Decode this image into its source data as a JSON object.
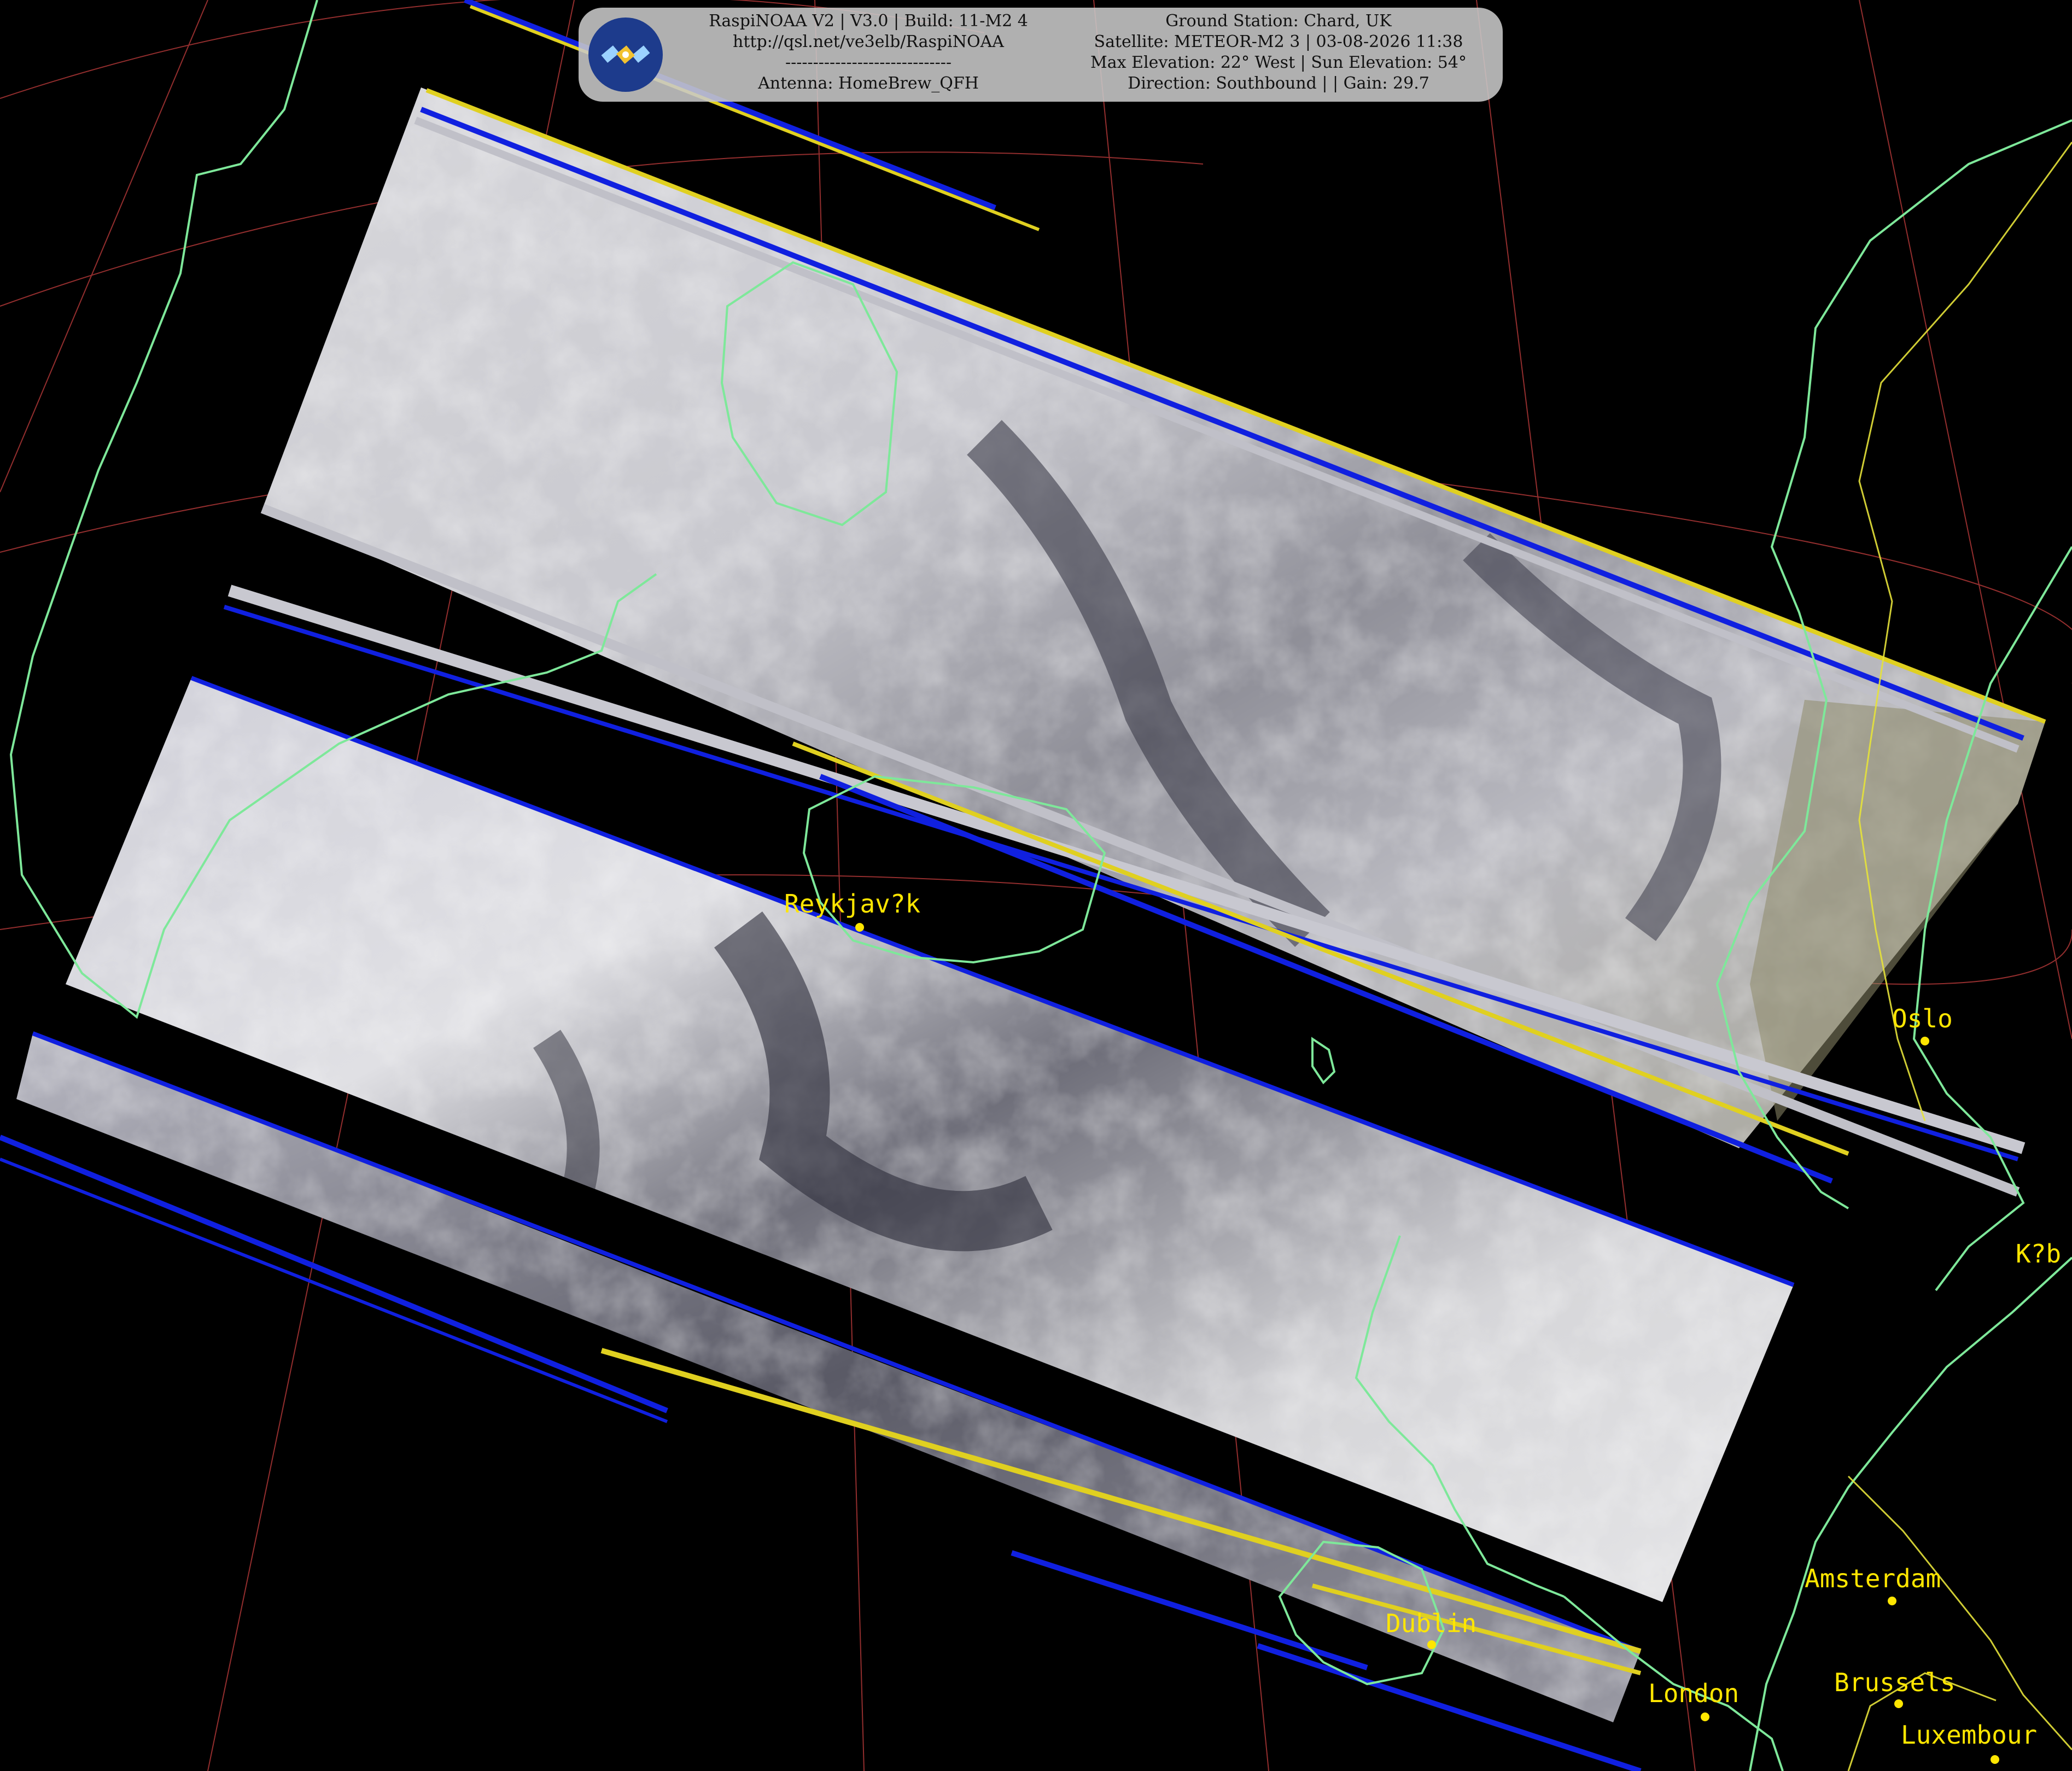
{
  "hud": {
    "logo_icon": "satellite-icon",
    "left_lines": [
      "RaspiNOAA V2 | V3.0 | Build: 11-M2 4",
      "http://qsl.net/ve3elb/RaspiNOAA",
      "------------------------------",
      "Antenna: HomeBrew_QFH"
    ],
    "right_lines": [
      "Ground Station: Chard, UK",
      "Satellite: METEOR-M2 3 | 03-08-2026 11:38",
      "Max Elevation: 22° West | Sun Elevation: 54°",
      "Direction: Southbound | | Gain: 29.7"
    ]
  },
  "cities": {
    "reykjavik": "Reykjav?k",
    "oslo": "Oslo",
    "kobenhavn": "K?b",
    "amsterdam": "Amsterdam",
    "dublin": "Dublin",
    "london": "London",
    "brussels": "Brussels",
    "luxembourg": "Luxembour"
  },
  "colors": {
    "background": "#000000",
    "coastline": "#7ee89a",
    "border": "#e6e23a",
    "graticule": "#b83a3a",
    "scanline_blue": "#1020e0",
    "scanline_yellow": "#e0d020",
    "city_label": "#ffe600"
  }
}
